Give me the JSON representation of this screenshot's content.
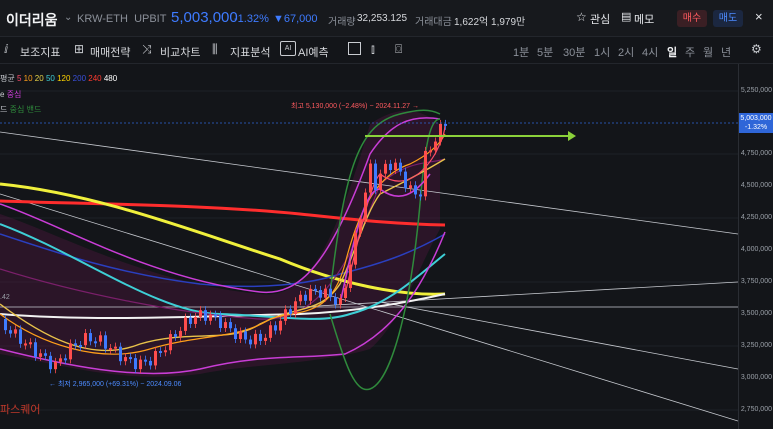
{
  "header": {
    "coin_name": "이더리움",
    "pair": "KRW-ETH",
    "exchange": "UPBIT",
    "price": "5,003,000",
    "change_pct": "-1.32%",
    "change_amount": "▼67,000",
    "volume_label": "거래량",
    "volume_value": "32,253.125",
    "amount_label": "거래대금",
    "amount_value": "1,622억 1,979만",
    "favorite_label": "관심",
    "memo_label": "메모",
    "buy_label": "매수",
    "sell_label": "매도"
  },
  "toolbar": {
    "items": [
      "보조지표",
      "매매전략",
      "비교차트",
      "지표분석",
      "AI예측"
    ],
    "timeframes": [
      "1분",
      "5분",
      "30분",
      "1시",
      "2시",
      "4시",
      "일",
      "주",
      "월",
      "년"
    ],
    "selected": "일"
  },
  "legend": {
    "ma_prefix": "평균",
    "ma_periods": [
      "5",
      "10",
      "20",
      "50",
      "120",
      "200",
      "240",
      "480"
    ],
    "ma_colors": [
      "#ff4d6d",
      "#ff9f1a",
      "#e8d54a",
      "#3ecfd6",
      "#ffd400",
      "#3a4fd8",
      "#ff3b30",
      "#ffffff"
    ],
    "line2_prefix": "e",
    "line2_label": "중심",
    "line3_prefix": "드",
    "line3_labels": [
      "중심",
      "밴드"
    ]
  },
  "axis": {
    "ticks": [
      "5,250,000",
      "5,003,000",
      "4,750,000",
      "4,500,000",
      "4,250,000",
      "4,000,000",
      "3,750,000",
      "3,500,000",
      "3,250,000",
      "3,000,000",
      "2,750,000"
    ],
    "current_price": "5,003,000",
    "current_pct": "-1.32%"
  },
  "annotations": {
    "high": "최고 5,130,000 (−2.48%) − 2024.11.27 →",
    "low": "← 최저 2,965,000 (+69.31%) − 2024.09.06",
    "left_label": ".42"
  },
  "watermark": "파스퀘어",
  "colors": {
    "up": "#ff4d4d",
    "down": "#3e7bff",
    "accent": "#3e7bff"
  }
}
